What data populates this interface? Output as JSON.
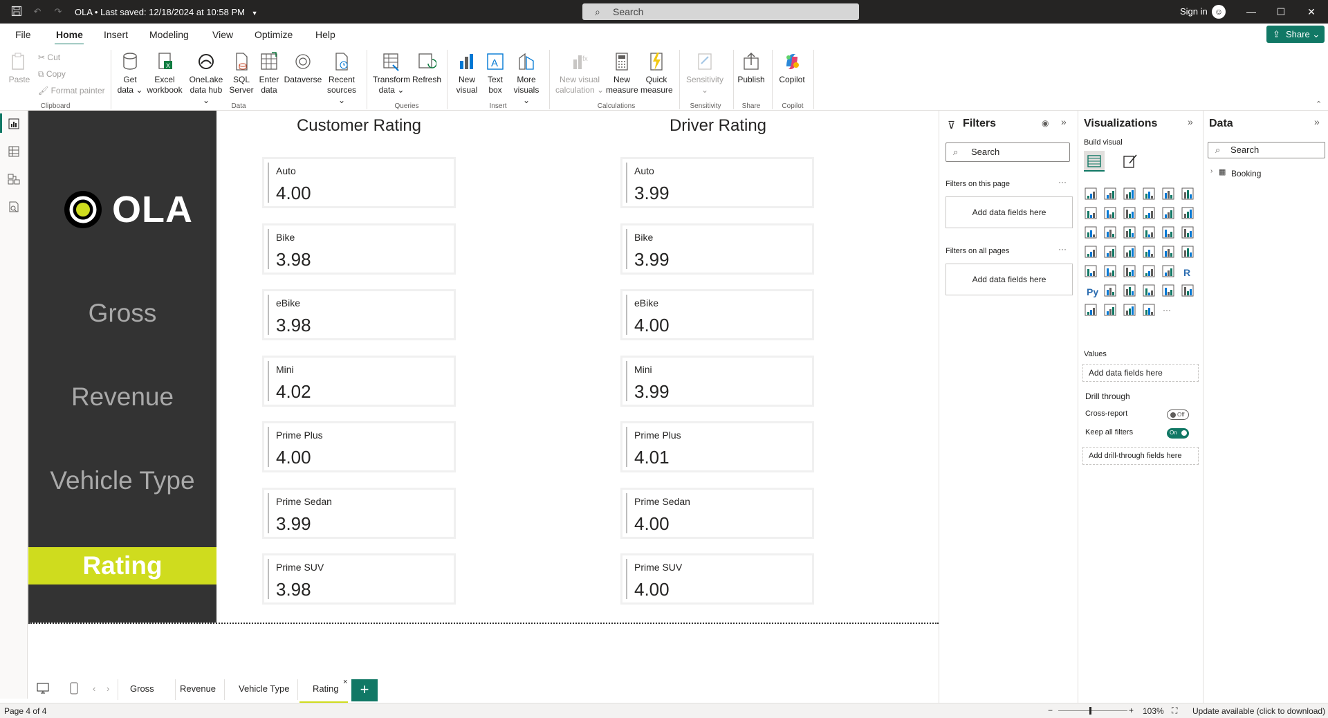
{
  "titlebar": {
    "title": "OLA • Last saved: 12/18/2024 at 10:58 PM",
    "search_placeholder": "Search",
    "sign_in": "Sign in"
  },
  "menu": {
    "items": [
      "File",
      "Home",
      "Insert",
      "Modeling",
      "View",
      "Optimize",
      "Help"
    ],
    "active": "Home",
    "share": "Share"
  },
  "ribbon": {
    "clipboard": {
      "paste": "Paste",
      "cut": "Cut",
      "copy": "Copy",
      "format_painter": "Format painter",
      "label": "Clipboard"
    },
    "data": {
      "get_data": [
        "Get",
        "data"
      ],
      "excel": [
        "Excel",
        "workbook"
      ],
      "onelake": [
        "OneLake",
        "data hub"
      ],
      "sql": [
        "SQL",
        "Server"
      ],
      "enter": [
        "Enter",
        "data"
      ],
      "dataverse": [
        "Dataverse"
      ],
      "recent": [
        "Recent",
        "sources"
      ],
      "label": "Data"
    },
    "queries": {
      "transform": [
        "Transform",
        "data"
      ],
      "refresh": [
        "Refresh"
      ],
      "label": "Queries"
    },
    "insert": {
      "new_visual": [
        "New",
        "visual"
      ],
      "text_box": [
        "Text",
        "box"
      ],
      "more_visuals": [
        "More",
        "visuals"
      ],
      "label": "Insert"
    },
    "calculations": {
      "new_visual_calc": [
        "New visual",
        "calculation"
      ],
      "new_measure": [
        "New",
        "measure"
      ],
      "quick_measure": [
        "Quick",
        "measure"
      ],
      "label": "Calculations"
    },
    "sensitivity": {
      "btn": [
        "Sensitivity"
      ],
      "label": "Sensitivity"
    },
    "share": {
      "publish": [
        "Publish"
      ],
      "label": "Share"
    },
    "copilot": {
      "btn": [
        "Copilot"
      ],
      "label": "Copilot"
    }
  },
  "sidepanel": {
    "logo_text": "OLA",
    "items": [
      "Gross",
      "Revenue",
      "Vehicle Type"
    ],
    "active": "Rating"
  },
  "report": {
    "customer_title": "Customer Rating",
    "driver_title": "Driver Rating",
    "customer_cards": [
      {
        "label": "Auto",
        "value": "4.00"
      },
      {
        "label": "Bike",
        "value": "3.98"
      },
      {
        "label": "eBike",
        "value": "3.98"
      },
      {
        "label": "Mini",
        "value": "4.02"
      },
      {
        "label": "Prime Plus",
        "value": "4.00"
      },
      {
        "label": "Prime Sedan",
        "value": "3.99"
      },
      {
        "label": "Prime SUV",
        "value": "3.98"
      }
    ],
    "driver_cards": [
      {
        "label": "Auto",
        "value": "3.99"
      },
      {
        "label": "Bike",
        "value": "3.99"
      },
      {
        "label": "eBike",
        "value": "4.00"
      },
      {
        "label": "Mini",
        "value": "3.99"
      },
      {
        "label": "Prime Plus",
        "value": "4.01"
      },
      {
        "label": "Prime Sedan",
        "value": "4.00"
      },
      {
        "label": "Prime SUV",
        "value": "4.00"
      }
    ]
  },
  "tabs": {
    "items": [
      "Gross",
      "Revenue",
      "Vehicle Type",
      "Rating"
    ],
    "active": "Rating",
    "close": "×",
    "add": "+"
  },
  "status": {
    "page": "Page 4 of 4",
    "zoom": "103%",
    "update": "Update available (click to download)"
  },
  "filters": {
    "title": "Filters",
    "search": "Search",
    "on_this_page": "Filters on this page",
    "on_all_pages": "Filters on all pages",
    "add_fields": "Add data fields here",
    "more": "···"
  },
  "visualizations": {
    "title": "Visualizations",
    "build_visual": "Build visual",
    "values": "Values",
    "add_fields": "Add data fields here",
    "drill_through": "Drill through",
    "cross_report": "Cross-report",
    "cross_report_state": "Off",
    "keep_all_filters": "Keep all filters",
    "keep_all_filters_state": "On",
    "add_drill": "Add drill-through fields here",
    "more": "···"
  },
  "data_pane": {
    "title": "Data",
    "search": "Search",
    "tables": [
      "Booking"
    ]
  },
  "colors": {
    "accent": "#117865",
    "ola_yellow": "#cfdc1e",
    "side_bg": "#333333",
    "titlebar_bg": "#252423"
  }
}
